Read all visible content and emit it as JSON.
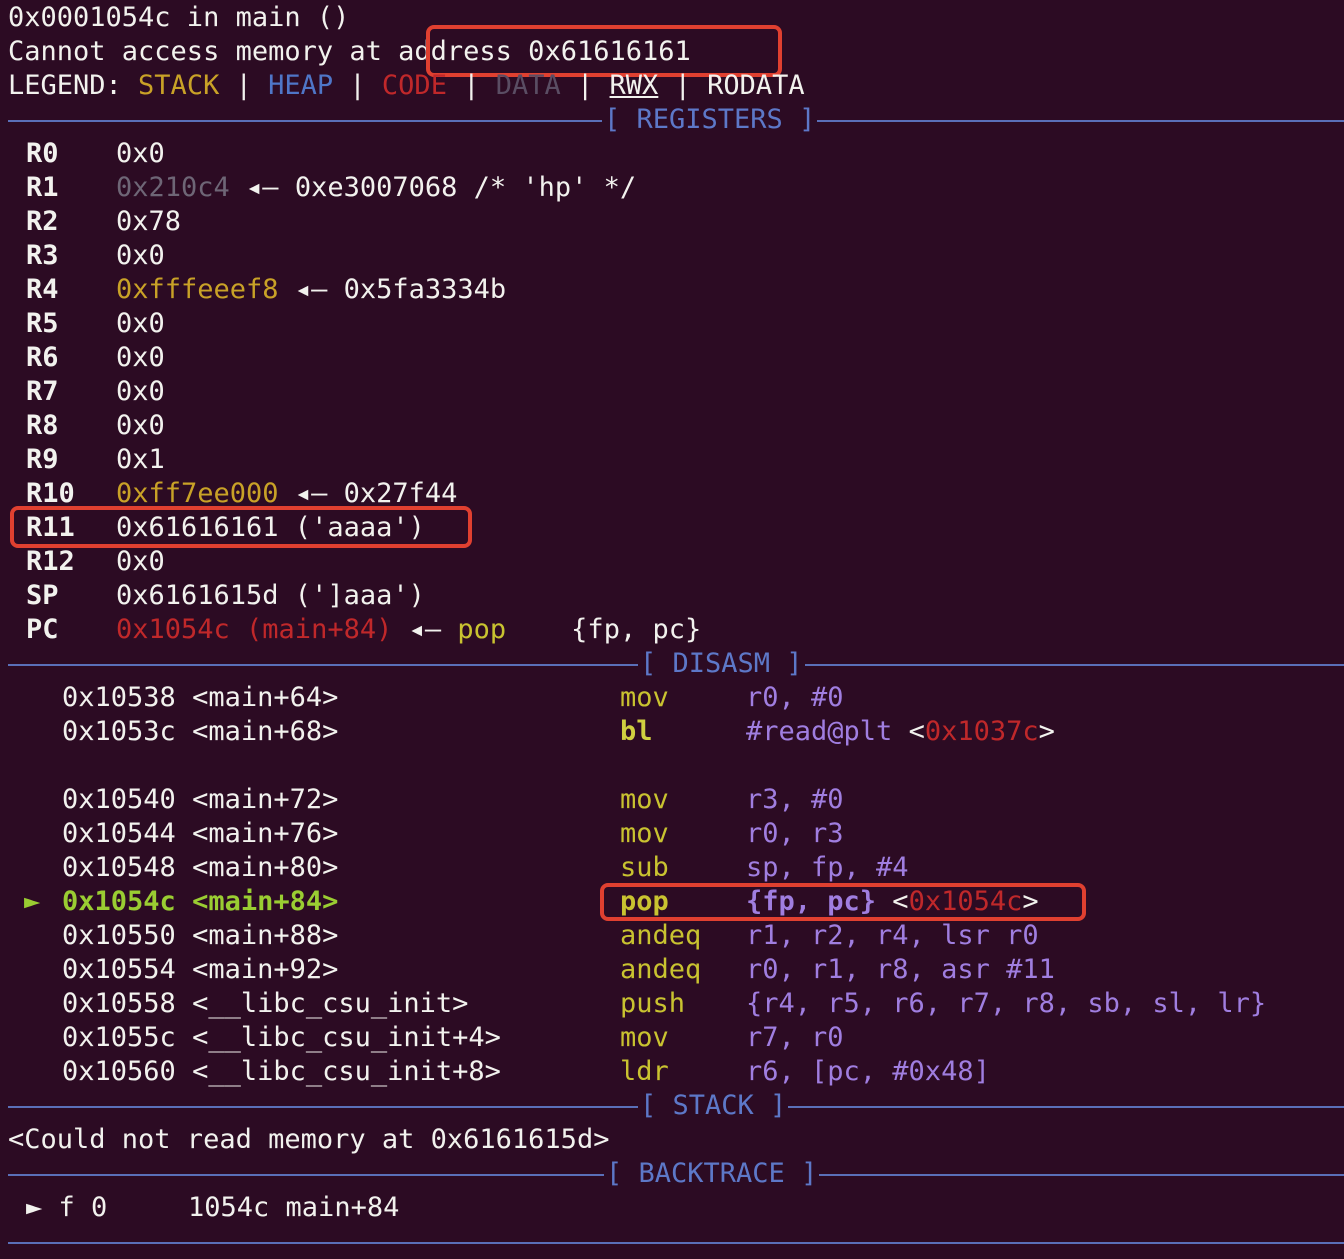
{
  "header": {
    "line1": "0x0001054c in main ()",
    "line2_prefix": "Cannot access memory at ",
    "line2_addr": "address 0x61616161",
    "legend_label": "LEGEND: ",
    "legend": [
      "STACK",
      "HEAP",
      "CODE",
      "DATA",
      "RWX",
      "RODATA"
    ],
    "legend_sep": " | "
  },
  "sections": {
    "registers": "[ REGISTERS ]",
    "disasm": "[ DISASM ]",
    "stack": "[ STACK ]",
    "backtrace": "[ BACKTRACE ]"
  },
  "registers": [
    {
      "name": "R0",
      "value": "0x0",
      "rest": ""
    },
    {
      "name": "R1",
      "value": "0x210c4",
      "rest": " ◂— 0xe3007068 /* 'hp' */"
    },
    {
      "name": "R2",
      "value": "0x78",
      "rest": ""
    },
    {
      "name": "R3",
      "value": "0x0",
      "rest": ""
    },
    {
      "name": "R4",
      "value": "0xfffeeef8",
      "rest": " ◂— 0x5fa3334b"
    },
    {
      "name": "R5",
      "value": "0x0",
      "rest": ""
    },
    {
      "name": "R6",
      "value": "0x0",
      "rest": ""
    },
    {
      "name": "R7",
      "value": "0x0",
      "rest": ""
    },
    {
      "name": "R8",
      "value": "0x0",
      "rest": ""
    },
    {
      "name": "R9",
      "value": "0x1",
      "rest": ""
    },
    {
      "name": "R10",
      "value": "0xff7ee000",
      "rest": " ◂— 0x27f44"
    },
    {
      "name": "R11",
      "value": "0x61616161 ('aaaa')",
      "rest": ""
    },
    {
      "name": "R12",
      "value": "0x0",
      "rest": ""
    },
    {
      "name": "SP",
      "value": "0x6161615d (']aaa')",
      "rest": ""
    },
    {
      "name": "PC",
      "value": "0x1054c (main+84)",
      "rest_arrow": " ◂— ",
      "rest_op": "pop",
      "rest_args": "    {fp, pc}"
    }
  ],
  "disasm": [
    {
      "addr": "0x10538",
      "sym": "<main+64>",
      "op": "mov",
      "args": "r0, #0"
    },
    {
      "addr": "0x1053c",
      "sym": "<main+68>",
      "op": "bl",
      "args": "#read@plt",
      "target_pre": " <",
      "target": "0x1037c",
      "target_post": ">"
    },
    {
      "addr": "0x10540",
      "sym": "<main+72>",
      "op": "mov",
      "args": "r3, #0"
    },
    {
      "addr": "0x10544",
      "sym": "<main+76>",
      "op": "mov",
      "args": "r0, r3"
    },
    {
      "addr": "0x10548",
      "sym": "<main+80>",
      "op": "sub",
      "args": "sp, fp, #4"
    },
    {
      "addr": "0x1054c",
      "sym": "<main+84>",
      "op": "pop",
      "args": "{fp, pc}",
      "target_pre": " <",
      "target": "0x1054c",
      "target_post": ">",
      "current": true,
      "marker": "►"
    },
    {
      "addr": "0x10550",
      "sym": "<main+88>",
      "op": "andeq",
      "args": "r1, r2, r4, lsr r0"
    },
    {
      "addr": "0x10554",
      "sym": "<main+92>",
      "op": "andeq",
      "args": "r0, r1, r8, asr #11"
    },
    {
      "addr": "0x10558",
      "sym": "<__libc_csu_init>",
      "op": "push",
      "args": "{r4, r5, r6, r7, r8, sb, sl, lr}"
    },
    {
      "addr": "0x1055c",
      "sym": "<__libc_csu_init+4>",
      "op": "mov",
      "args": "r7, r0"
    },
    {
      "addr": "0x10560",
      "sym": "<__libc_csu_init+8>",
      "op": "ldr",
      "args": "r6, [pc, #0x48]"
    }
  ],
  "stack_msg": "<Could not read memory at 0x6161615d>",
  "backtrace": {
    "marker": "►",
    "frame": " f 0",
    "addr": "1054c",
    "sym": "main+84"
  },
  "colors": {
    "background": "#2c0b23",
    "highlight_box": "#e04030",
    "separator": "#5a6fb8"
  }
}
